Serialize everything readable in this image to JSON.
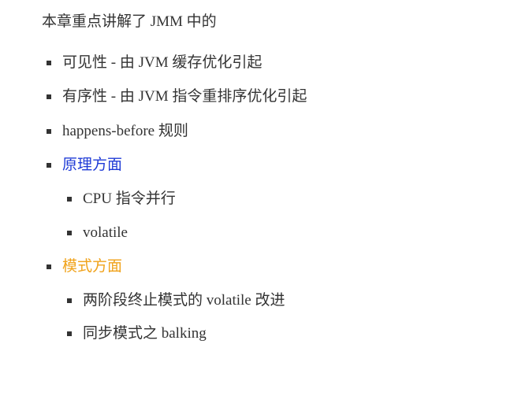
{
  "intro": "本章重点讲解了 JMM 中的",
  "colors": {
    "text": "#333333",
    "blue_heading": "#1f3bd6",
    "orange_heading": "#f0a21a",
    "bullet": "#333333"
  },
  "items": [
    {
      "text": "可见性 - 由 JVM 缓存优化引起",
      "level": 1,
      "color": "#333333"
    },
    {
      "text": "有序性 - 由 JVM 指令重排序优化引起",
      "level": 1,
      "color": "#333333"
    },
    {
      "text": "happens-before 规则",
      "level": 1,
      "color": "#333333"
    },
    {
      "text": "原理方面",
      "level": 1,
      "color": "#1f3bd6"
    },
    {
      "text": "CPU 指令并行",
      "level": 2,
      "color": "#333333"
    },
    {
      "text": "volatile",
      "level": 2,
      "color": "#333333"
    },
    {
      "text": "模式方面",
      "level": 1,
      "color": "#f0a21a"
    },
    {
      "text": "两阶段终止模式的 volatile 改进",
      "level": 2,
      "color": "#333333"
    },
    {
      "text": "同步模式之 balking",
      "level": 2,
      "color": "#333333"
    }
  ]
}
